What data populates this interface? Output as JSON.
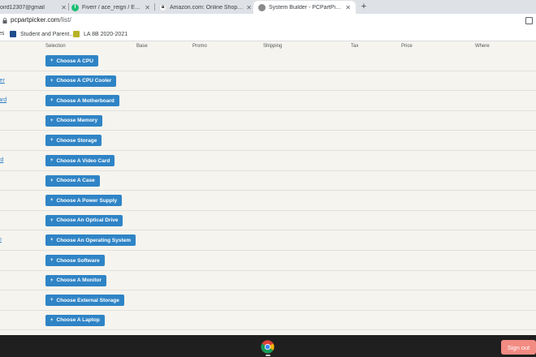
{
  "tabs": [
    {
      "title": "oird12307@gmail",
      "favicon_color": "#ea4335",
      "active": false
    },
    {
      "title": "Fiverr / ace_reign / Edit Gig",
      "favicon_color": "#1dbf73",
      "favicon_glyph": "f",
      "active": false
    },
    {
      "title": "Amazon.com: Online Shopping",
      "favicon_color": "#ffffff",
      "favicon_glyph": "a",
      "active": false
    },
    {
      "title": "System Builder - PCPartPicker",
      "favicon_color": "#8a8a8a",
      "active": true
    }
  ],
  "address": {
    "host": "pcpartpicker.com",
    "path": "/list/"
  },
  "bookmarks": [
    {
      "label": "es",
      "color": "#1a73e8"
    },
    {
      "label": "Student and Parent...",
      "color": "#1f4e8c"
    },
    {
      "label": "LA 8B 2020-2021",
      "color": "#b7b324"
    }
  ],
  "table": {
    "headers": [
      "Selection",
      "Base",
      "Promo",
      "Shipping",
      "Tax",
      "Price",
      "Where"
    ],
    "rows": [
      {
        "component": "",
        "button": "Choose A CPU"
      },
      {
        "component": "ler",
        "button": "Choose A CPU Cooler"
      },
      {
        "component": "ard",
        "button": "Choose A Motherboard"
      },
      {
        "component": "",
        "button": "Choose Memory"
      },
      {
        "component": "",
        "button": "Choose Storage"
      },
      {
        "component": "rd",
        "button": "Choose A Video Card"
      },
      {
        "component": "",
        "button": "Choose A Case"
      },
      {
        "component": "",
        "button": "Choose A Power Supply"
      },
      {
        "component": "",
        "button": "Choose An Optical Drive"
      },
      {
        "component": "n",
        "button": "Choose An Operating System"
      },
      {
        "component": "",
        "button": "Choose Software"
      },
      {
        "component": "",
        "button": "Choose A Monitor"
      },
      {
        "component": "",
        "button": "Choose External Storage"
      },
      {
        "component": "",
        "button": "Choose A Laptop"
      }
    ]
  },
  "taskbar": {
    "signout_label": "Sign out",
    "app_icon": "chrome-icon"
  },
  "colors": {
    "button": "#2f84c6",
    "link": "#2c7ec5",
    "signout": "#f28b82"
  }
}
